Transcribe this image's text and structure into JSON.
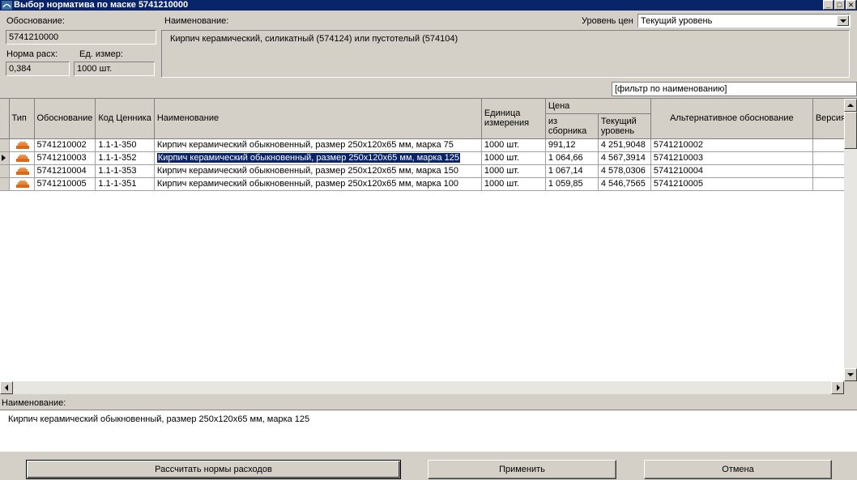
{
  "window": {
    "title": "Выбор норматива по маске 5741210000",
    "icon": "brick-icon"
  },
  "header": {
    "code_label": "Обоснование:",
    "code_value": "5741210000",
    "name_label": "Наименование:",
    "name_value": "Кирпич керамический, силикатный (574124) или пустотелый (574104)",
    "norm_label": "Норма расх:",
    "norm_value": "0,384",
    "unit_label": "Ед. измер:",
    "unit_value": "1000 шт.",
    "price_level_label": "Уровень цен",
    "price_level_value": "Текущий уровень"
  },
  "filter": {
    "value": "[фильтр по наименованию]"
  },
  "grid": {
    "headers": {
      "type": "Тип",
      "code": "Обоснование",
      "price_code": "Код Ценника",
      "name": "Наименование",
      "unit": "Единица измерения",
      "price": "Цена",
      "price_book": "из сборника",
      "price_current": "Текущий уровень",
      "alt_code": "Альтернативное обоснование",
      "version": "Версия"
    },
    "rows": [
      {
        "code": "5741210002",
        "price_code": "1.1-1-350",
        "name": "Кирпич керамический обыкновенный, размер 250x120x65 мм, марка 75",
        "unit": "1000 шт.",
        "price_book": "991,12",
        "price_current": "4 251,9048",
        "alt_code": "5741210002",
        "version": ""
      },
      {
        "code": "5741210003",
        "price_code": "1.1-1-352",
        "name": "Кирпич керамический обыкновенный, размер 250x120x65 мм, марка 125",
        "unit": "1000 шт.",
        "price_book": "1 064,66",
        "price_current": "4 567,3914",
        "alt_code": "5741210003",
        "version": ""
      },
      {
        "code": "5741210004",
        "price_code": "1.1-1-353",
        "name": "Кирпич керамический обыкновенный, размер 250x120x65 мм, марка 150",
        "unit": "1000 шт.",
        "price_book": "1 067,14",
        "price_current": "4 578,0306",
        "alt_code": "5741210004",
        "version": ""
      },
      {
        "code": "5741210005",
        "price_code": "1.1-1-351",
        "name": "Кирпич керамический обыкновенный, размер 250x120x65 мм, марка 100",
        "unit": "1000 шт.",
        "price_book": "1 059,85",
        "price_current": "4 546,7565",
        "alt_code": "5741210005",
        "version": ""
      }
    ],
    "selected_row": 1
  },
  "description": {
    "label": "Наименование:",
    "value": "Кирпич керамический обыкновенный, размер 250x120x65 мм, марка 125"
  },
  "buttons": {
    "calculate": "Рассчитать нормы расходов",
    "apply": "Применить",
    "cancel": "Отмена"
  },
  "colors": {
    "titlebar": "#0a246a",
    "selection": "#0a246a",
    "face": "#d4d0c8",
    "brick": "#d86a1e"
  }
}
